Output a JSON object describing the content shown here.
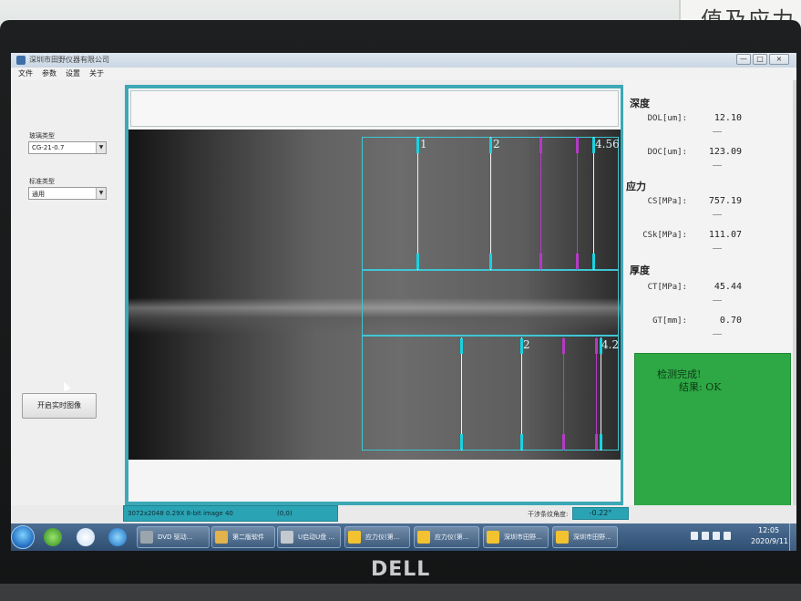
{
  "wall": {
    "sign_text": "值及应力"
  },
  "monitor": {
    "brand": "DELL"
  },
  "window": {
    "title": "深圳市田野仪器有限公司",
    "controls": {
      "minimize": "—",
      "maximize": "□",
      "close": "×"
    }
  },
  "menu": [
    "文件",
    "参数",
    "设置",
    "关于"
  ],
  "left_panel": {
    "glass_type_label": "玻璃类型",
    "glass_type_value": "CG-21-0.7",
    "standard_type_label": "标准类型",
    "standard_type_value": "通用",
    "live_button_label": "开启实时图像"
  },
  "image_view": {
    "upper_labels": [
      "1",
      "2",
      "4.56"
    ],
    "lower_labels": [
      "2",
      "4.2"
    ],
    "colors": {
      "frame": "#3da8b6",
      "roi": "#3fc6d4",
      "white_line": "#f2f2f2",
      "cyan_tick": "#19d2e0",
      "purple": "#b43bc4"
    }
  },
  "measurements": {
    "depth_title": "深度",
    "dol_label": "DOL[um]:",
    "dol_value": "12.10",
    "doc_label": "DOC[um]:",
    "doc_value": "123.09",
    "stress_title": "应力",
    "cs_label": "CS[MPa]:",
    "cs_value": "757.19",
    "csk_label": "CSk[MPa]:",
    "csk_value": "111.07",
    "thickness_title": "厚度",
    "ct_label": "CT[MPa]:",
    "ct_value": "45.44",
    "gt_label": "GT[mm]:",
    "gt_value": "0.70",
    "separator": "—"
  },
  "result": {
    "line1": "检测完成!",
    "line2": "结果: OK",
    "color": "#2ea845"
  },
  "statusbar": {
    "image_info": "3072x2048 0.29X 8-bit image 40",
    "coords": "(0,0)",
    "angle_label": "干涉条纹角度:",
    "angle_value": "-0.22°"
  },
  "taskbar": {
    "items": [
      {
        "label": "DVD 驱动..."
      },
      {
        "label": "第二版软件"
      },
      {
        "label": "U启动U盘 ..."
      },
      {
        "label": "应力仪(第..."
      },
      {
        "label": "应力仪(第..."
      },
      {
        "label": "深圳市田野..."
      },
      {
        "label": "深圳市田野..."
      }
    ],
    "time": "12:05",
    "date": "2020/9/11"
  }
}
